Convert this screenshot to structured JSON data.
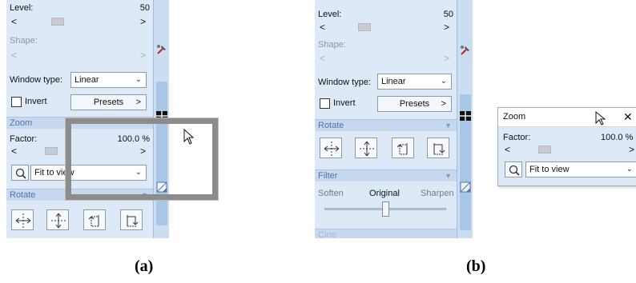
{
  "panel_a": {
    "level": {
      "label": "Level:",
      "value": "50"
    },
    "shape": {
      "label": "Shape:"
    },
    "window_type": {
      "label": "Window type:",
      "value": "Linear"
    },
    "invert": {
      "label": "Invert",
      "checked": false
    },
    "presets": {
      "label": "Presets",
      "arrow": ">"
    },
    "zoom_section": {
      "label": "Zoom"
    },
    "factor": {
      "label": "Factor:",
      "value": "100.0 %"
    },
    "fit": {
      "value": "Fit to view"
    },
    "rotate_section": {
      "label": "Rotate"
    },
    "arrows": {
      "left": "<",
      "right": ">"
    }
  },
  "panel_b": {
    "level": {
      "label": "Level:",
      "value": "50"
    },
    "shape": {
      "label": "Shape:"
    },
    "window_type": {
      "label": "Window type:",
      "value": "Linear"
    },
    "invert": {
      "label": "Invert",
      "checked": false
    },
    "presets": {
      "label": "Presets",
      "arrow": ">"
    },
    "rotate_section": {
      "label": "Rotate"
    },
    "filter_section": {
      "label": "Filter"
    },
    "filter": {
      "soften": "Soften",
      "original": "Original",
      "sharpen": "Sharpen",
      "level": 0.5
    },
    "cine_section": {
      "label": "Cine"
    },
    "arrows": {
      "left": "<",
      "right": ">"
    }
  },
  "floating_zoom": {
    "title": "Zoom",
    "close": "✕",
    "factor": {
      "label": "Factor:",
      "value": "100.0 %"
    },
    "fit": {
      "value": "Fit to view"
    },
    "arrows": {
      "left": "<",
      "right": ">"
    }
  },
  "captions": {
    "a": "(a)",
    "b": "(b)"
  },
  "colors": {
    "panel": "#dde9f6",
    "section_header": "#c6d9ee",
    "section_text": "#4f74a8"
  }
}
